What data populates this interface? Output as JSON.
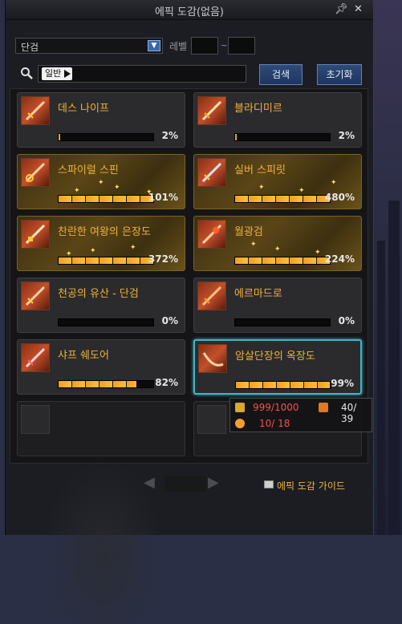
{
  "window": {
    "title": "에픽 도감(없음)",
    "pin_icon": "pin-icon",
    "close_icon": "close-icon"
  },
  "filters": {
    "category_value": "단검",
    "level_label": "레벨",
    "level_min": "",
    "level_max": "",
    "range_separator": "~",
    "search_chip": "일반",
    "search_value": "",
    "search_button": "검색",
    "reset_button": "초기화"
  },
  "items": [
    {
      "name": "데스 나이프",
      "progress_pct": 2,
      "percent_label": "2%",
      "style": "normal"
    },
    {
      "name": "블라디미르",
      "progress_pct": 2,
      "percent_label": "2%",
      "style": "normal"
    },
    {
      "name": "스파이럴 스핀",
      "progress_pct": 100,
      "percent_label": "101%",
      "style": "gold"
    },
    {
      "name": "실버 스피릿",
      "progress_pct": 100,
      "percent_label": "480%",
      "style": "gold"
    },
    {
      "name": "찬란한 여왕의 은장도",
      "progress_pct": 100,
      "percent_label": "372%",
      "style": "gold"
    },
    {
      "name": "월광검",
      "progress_pct": 100,
      "percent_label": "224%",
      "style": "gold"
    },
    {
      "name": "천공의 유산 - 단검",
      "progress_pct": 0,
      "percent_label": "0%",
      "style": "normal"
    },
    {
      "name": "에르마드로",
      "progress_pct": 0,
      "percent_label": "0%",
      "style": "normal"
    },
    {
      "name": "샤프 쉐도어",
      "progress_pct": 82,
      "percent_label": "82%",
      "style": "normal"
    },
    {
      "name": "암살단장의 옥장도",
      "progress_pct": 99,
      "percent_label": "99%",
      "style": "selected"
    }
  ],
  "tooltip": {
    "row1_value": "999/1000",
    "row1_value_color": "#ff4a4a",
    "row1_right": "40/  39",
    "row2_value": "10/  18",
    "row2_value_color": "#ff4a4a"
  },
  "footer": {
    "prev_icon": "triangle-left-icon",
    "next_icon": "triangle-right-icon",
    "guide_label": "에픽 도감 가이드"
  },
  "colors": {
    "accent_gold": "#f0b13a",
    "selected_border": "#3fb4c9",
    "button_blue": "#2f4b78"
  }
}
